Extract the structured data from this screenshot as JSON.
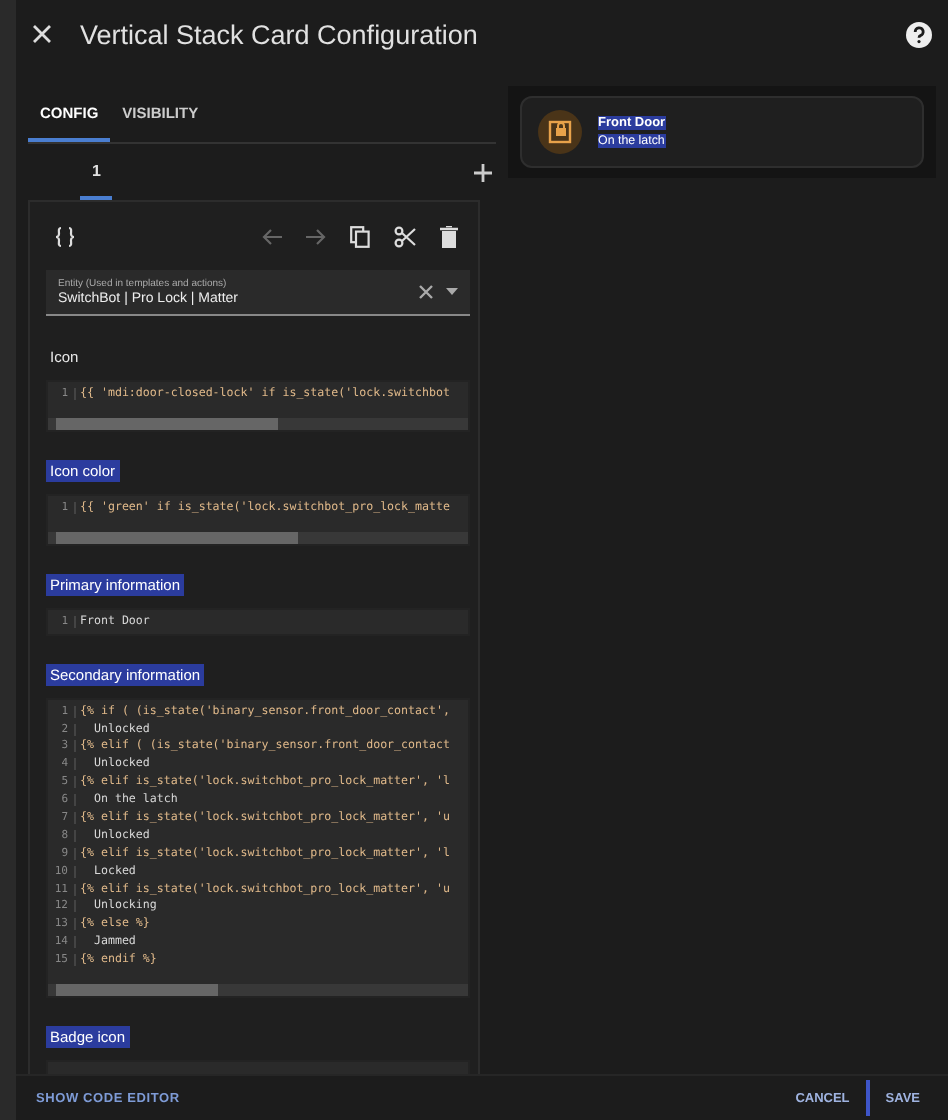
{
  "dialog": {
    "title": "Vertical Stack Card Configuration"
  },
  "tabs": [
    {
      "label": "CONFIG",
      "selected": true
    },
    {
      "label": "VISIBILITY",
      "selected": false
    }
  ],
  "card_tabs": [
    {
      "label": "1",
      "selected": true
    }
  ],
  "entity_field": {
    "label": "Entity (Used in templates and actions)",
    "value": "SwitchBot | Pro Lock | Matter"
  },
  "sections": [
    {
      "label": "Icon",
      "highlighted": false,
      "lines": [
        {
          "number": "1",
          "kind": "template",
          "text": "{{ 'mdi:door-closed-lock' if is_state('lock.switchbot"
        }
      ]
    },
    {
      "label": "Icon color",
      "highlighted": true,
      "lines": [
        {
          "number": "1",
          "kind": "template",
          "text": "{{ 'green' if is_state('lock.switchbot_pro_lock_matte"
        }
      ]
    },
    {
      "label": "Primary information",
      "highlighted": true,
      "lines": [
        {
          "number": "1",
          "kind": "text",
          "text": "Front Door"
        }
      ]
    },
    {
      "label": "Secondary information",
      "highlighted": true,
      "lines": [
        {
          "number": "1",
          "kind": "template",
          "text": "{% if ( (is_state('binary_sensor.front_door_contact',"
        },
        {
          "number": "2",
          "kind": "text",
          "text": "  Unlocked"
        },
        {
          "number": "3",
          "kind": "template",
          "text": "{% elif ( (is_state('binary_sensor.front_door_contact"
        },
        {
          "number": "4",
          "kind": "text",
          "text": "  Unlocked"
        },
        {
          "number": "5",
          "kind": "template",
          "text": "{% elif is_state('lock.switchbot_pro_lock_matter', 'l"
        },
        {
          "number": "6",
          "kind": "text",
          "text": "  On the latch"
        },
        {
          "number": "7",
          "kind": "template",
          "text": "{% elif is_state('lock.switchbot_pro_lock_matter', 'u"
        },
        {
          "number": "8",
          "kind": "text",
          "text": "  Unlocked"
        },
        {
          "number": "9",
          "kind": "template",
          "text": "{% elif is_state('lock.switchbot_pro_lock_matter', 'l"
        },
        {
          "number": "10",
          "kind": "text",
          "text": "  Locked"
        },
        {
          "number": "11",
          "kind": "template",
          "text": "{% elif is_state('lock.switchbot_pro_lock_matter', 'u"
        },
        {
          "number": "12",
          "kind": "text",
          "text": "  Unlocking"
        },
        {
          "number": "13",
          "kind": "template",
          "text": "{% else %}"
        },
        {
          "number": "14",
          "kind": "text",
          "text": "  Jammed"
        },
        {
          "number": "15",
          "kind": "template",
          "text": "{% endif %}"
        }
      ]
    },
    {
      "label": "Badge icon",
      "highlighted": true
    }
  ],
  "preview": {
    "primary": "Front Door",
    "secondary": "On the latch",
    "highlighted": true
  },
  "footer": {
    "link": "SHOW CODE EDITOR",
    "buttons": [
      "CANCEL",
      "SAVE"
    ]
  }
}
